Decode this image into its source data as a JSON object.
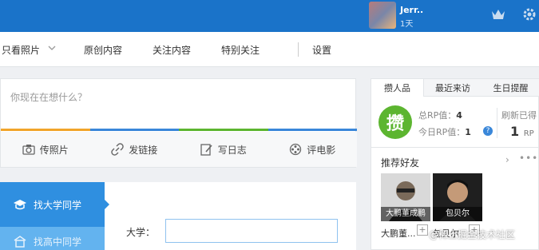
{
  "topbar": {
    "username": "Jerr..",
    "days": "1天"
  },
  "nav": {
    "items": [
      "只看照片",
      "原创内容",
      "关注内容",
      "特别关注",
      "设置"
    ]
  },
  "status": {
    "placeholder": "你现在在想什么？",
    "actions": [
      "传照片",
      "发链接",
      "写日志",
      "评电影"
    ],
    "colors": [
      "#f1a52a",
      "#3a87d9",
      "#5cb530",
      "#3a87d9"
    ]
  },
  "finder": {
    "tabs": [
      "找大学同学",
      "找高中同学"
    ],
    "university_label": "大学："
  },
  "right_panel": {
    "tabs": [
      "攒人品",
      "最近来访",
      "生日提醒"
    ],
    "badge": "攒",
    "total_rp_label": "总RP值：",
    "total_rp_value": "4",
    "today_rp_label": "今日RP值：",
    "today_rp_value": "1",
    "help": "?",
    "refresh_label": "刷新已得",
    "refresh_value": "1",
    "refresh_unit": "RP",
    "recommend_title": "推荐好友",
    "more": "›",
    "dots": "•••",
    "friends": [
      {
        "caption": "大鹏董成鹏",
        "name": "大鹏董..."
      },
      {
        "caption": "包贝尔",
        "name": "包贝尔"
      }
    ]
  },
  "watermark": "@稀土掘金技术社区"
}
